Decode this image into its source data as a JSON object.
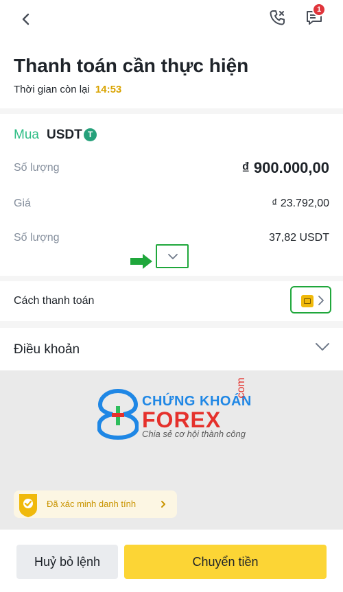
{
  "header": {
    "back_icon": "chevron-left-icon",
    "phone_icon": "phone-icon",
    "chat_icon": "chat-icon",
    "notification_count": "1"
  },
  "page": {
    "title": "Thanh toán cần thực hiện",
    "time_label": "Thời gian còn lại",
    "time_value": "14:53"
  },
  "order": {
    "side": "Mua",
    "asset": "USDT",
    "asset_icon_glyph": "T",
    "rows": [
      {
        "label": "Số lượng",
        "value": "₫ 900.000,00"
      },
      {
        "label": "Giá",
        "value": "₫ 23.792,00"
      },
      {
        "label": "Số lượng",
        "value": "37,82 USDT"
      }
    ]
  },
  "payment": {
    "label": "Cách thanh toán"
  },
  "terms": {
    "label": "Điều khoản"
  },
  "watermark": {
    "line1": "CHỨNG KHOÁN",
    "line2": "FOREX",
    "com": ".com",
    "slogan": "Chia sẻ cơ hội thành công"
  },
  "verify": {
    "label": "Đã xác minh danh tính"
  },
  "actions": {
    "cancel": "Huỷ bỏ lệnh",
    "transfer": "Chuyển tiền"
  },
  "colors": {
    "buy_green": "#2ebd85",
    "timer_yellow": "#d9a300",
    "primary_yellow": "#fcd535",
    "annotation_green": "#1fa73b",
    "badge_red": "#e0353b"
  }
}
